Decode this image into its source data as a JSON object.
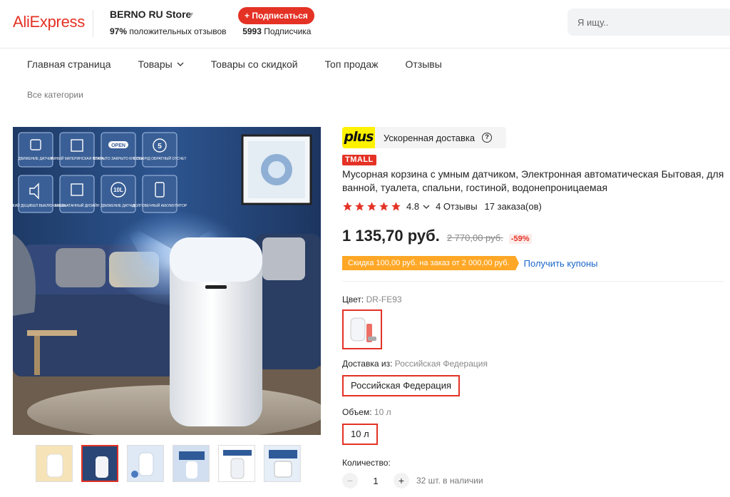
{
  "header": {
    "logo": "AliExpress",
    "store_name": "BERNO RU Store",
    "positive_pct": "97%",
    "positive_label": "положительных отзывов",
    "subscribers_count": "5993",
    "subscribers_label": "Подписчика",
    "subscribe_label": "+ Подписаться",
    "search_placeholder": "Я ищу.."
  },
  "nav": {
    "items": [
      "Главная страница",
      "Товары",
      "Товары со скидкой",
      "Топ продаж",
      "Отзывы"
    ],
    "all_categories": "Все категории"
  },
  "gallery": {
    "feature_labels": [
      "ДВИЖЕНИЕ ДАТЧИК",
      "УМНЫЙ МАТЕРИНСКАЯ ПЛАТА",
      "ОТКРЫТО ЗАКРЫТО КНОПКА",
      "5 СЕКУНД ОБРАТНЫЙ ОТСЧЕТ",
      "НИЗКИЙ ДЕЦИБЕЛ ВЫКЛЮЧАТЕЛЬ",
      "ЗАПЕЧАТАННЫЙ ДИЗАЙН",
      "ДВИЖЕНИЕ ДАТЧИК",
      "ДОЛГОВЕЧНЫЙ АККУМУЛЯТОР"
    ],
    "icon_texts": [
      "OPEN",
      "5",
      "10L"
    ],
    "thumbnail_count": 6,
    "active_thumbnail": 2
  },
  "product": {
    "plus_logo": "plus",
    "plus_text": "Ускоренная доставка",
    "badge": "TMALL",
    "title": "Мусорная корзина с умным датчиком, Электронная автоматическая Бытовая, для ванной, туалета, спальни, гостиной, водонепроницаемая",
    "rating": "4.8",
    "stars": 5,
    "reviews": "4 Отзывы",
    "orders": "17 заказа(ов)",
    "price": "1 135,70 руб.",
    "old_price": "2 770,00 руб.",
    "discount": "-59%",
    "coupon": "Скидка 100,00 руб. на заказ от 2 000,00 руб.",
    "get_coupons": "Получить купоны",
    "color_label": "Цвет:",
    "color_value": "DR-FE93",
    "ship_label": "Доставка из:",
    "ship_value": "Российская Федерация",
    "ship_option": "Российская Федерация",
    "volume_label": "Объем:",
    "volume_value": "10 л",
    "volume_option": "10 л",
    "qty_label": "Количество:",
    "qty_value": "1",
    "stock": "32 шт. в наличии"
  },
  "colors": {
    "brand_red": "#e43225",
    "plus_yellow": "#fff200",
    "coupon_orange": "#ffa726",
    "link_blue": "#1a66c9"
  }
}
